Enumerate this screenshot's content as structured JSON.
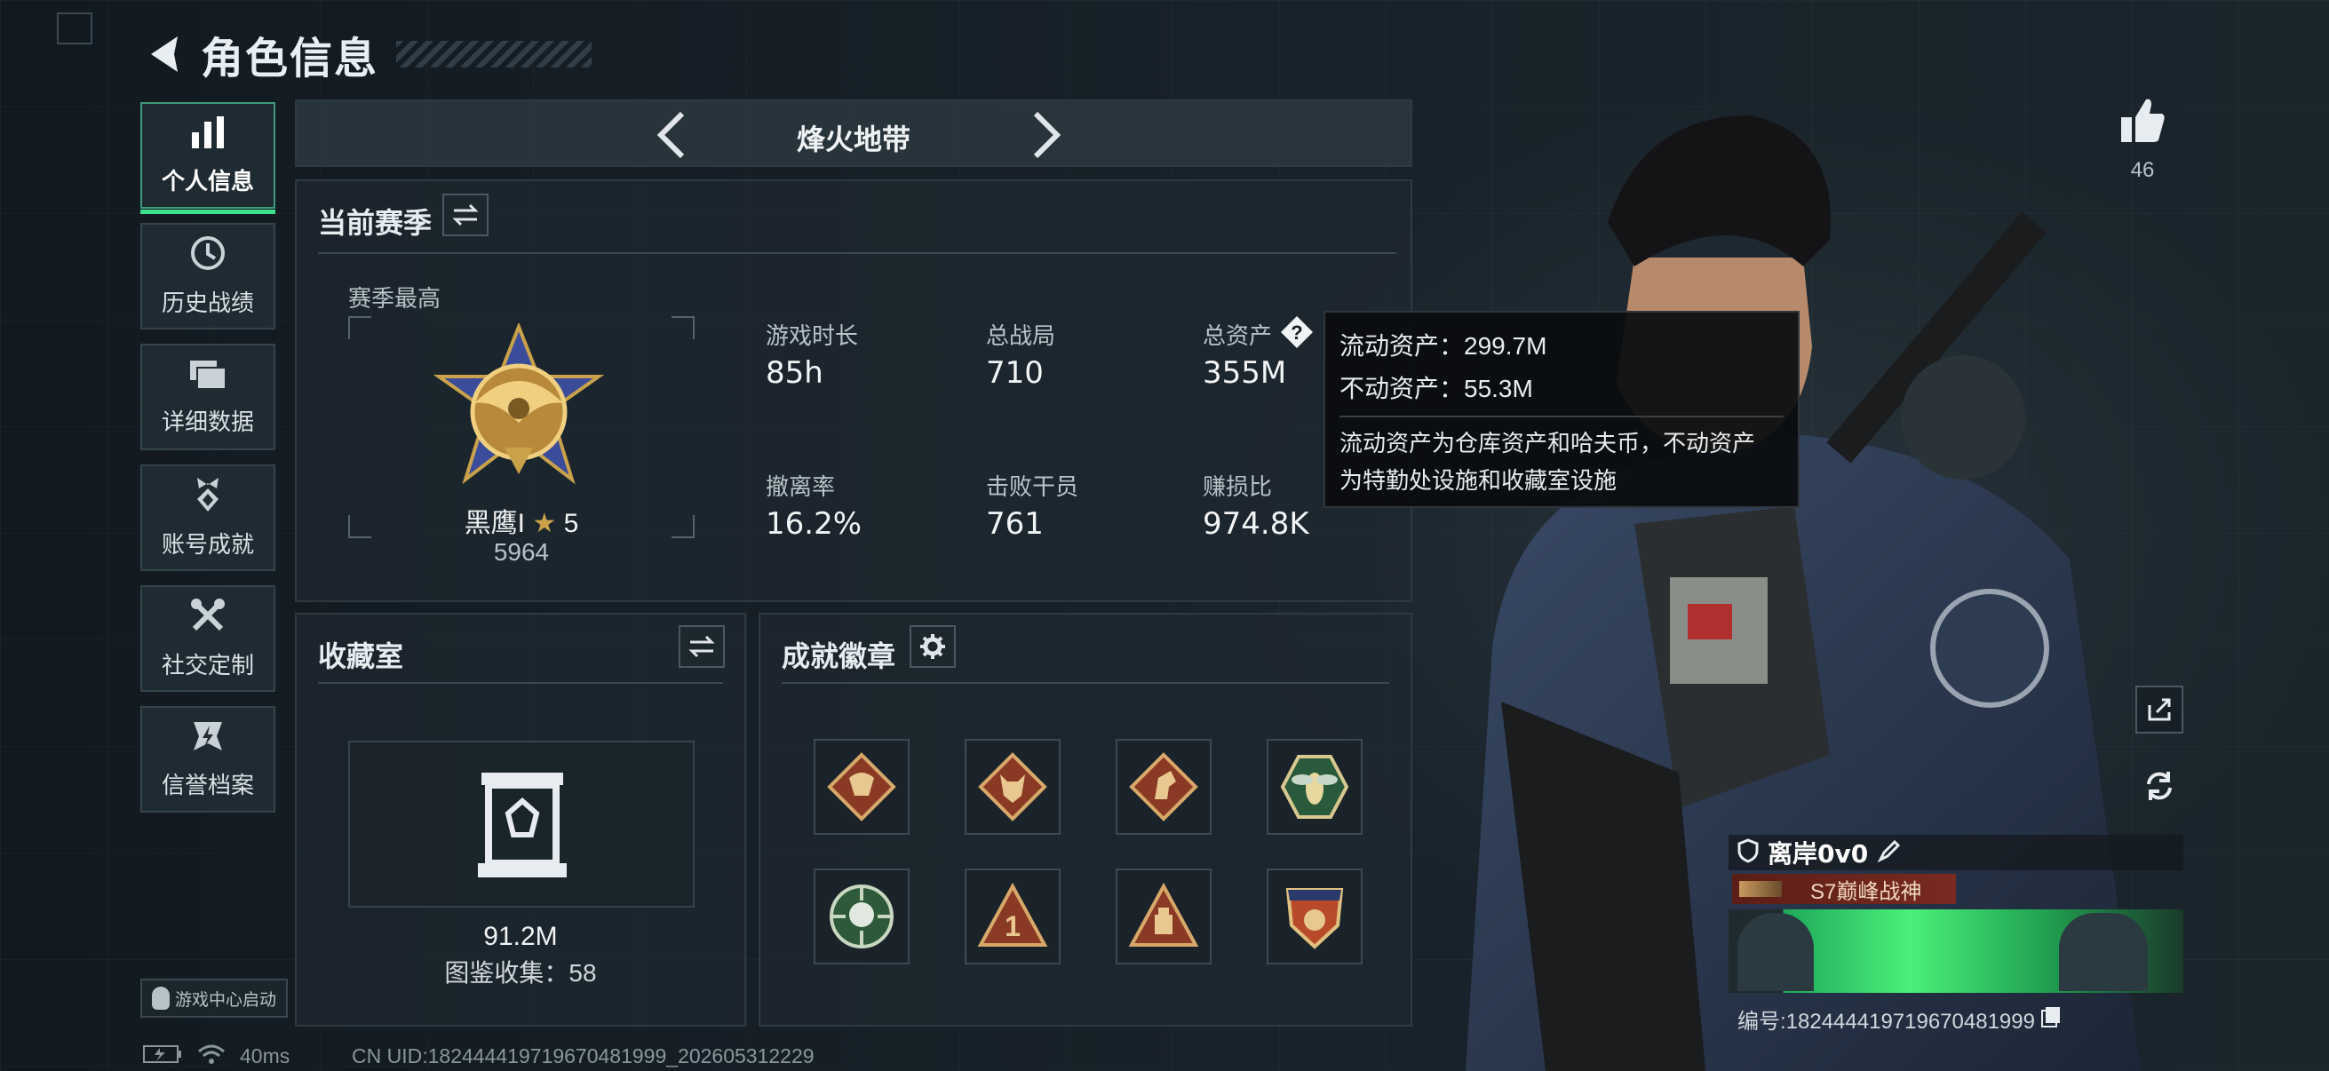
{
  "page": {
    "title": "角色信息"
  },
  "likes": {
    "count": "46"
  },
  "sidebar": {
    "items": [
      {
        "label": "个人信息",
        "icon": "bar-chart-icon",
        "active": true
      },
      {
        "label": "历史战绩",
        "icon": "history-icon"
      },
      {
        "label": "详细数据",
        "icon": "folder-icon"
      },
      {
        "label": "账号成就",
        "icon": "achievement-icon"
      },
      {
        "label": "社交定制",
        "icon": "tools-icon"
      },
      {
        "label": "信誉档案",
        "icon": "reputation-icon"
      }
    ],
    "game_center_label": "游戏中心启动"
  },
  "mode_switcher": {
    "label": "烽火地带"
  },
  "season": {
    "title": "当前赛季",
    "best_label": "赛季最高",
    "rank_name": "黑鹰I",
    "rank_stars": "5",
    "rank_score": "5964",
    "stats": [
      {
        "label": "游戏时长",
        "value": "85h"
      },
      {
        "label": "总战局",
        "value": "710"
      },
      {
        "label": "总资产",
        "value": "355M",
        "has_help": true
      },
      {
        "label": "撤离率",
        "value": "16.2%"
      },
      {
        "label": "击败干员",
        "value": "761"
      },
      {
        "label": "赚损比",
        "value": "974.8K"
      }
    ]
  },
  "tooltip": {
    "liquid": "流动资产：299.7M",
    "fixed": "不动资产：55.3M",
    "desc_line1": "流动资产为仓库资产和哈夫币，不动资产",
    "desc_line2": "为特勤处设施和收藏室设施"
  },
  "collection": {
    "title": "收藏室",
    "value": "91.2M",
    "catalog": "图鉴收集：58"
  },
  "badges": {
    "title": "成就徽章",
    "items": [
      "dragon-badge-icon",
      "wolf-badge-icon",
      "horse-badge-icon",
      "hornet-badge-icon",
      "skull-scope-badge-icon",
      "number-one-badge-icon",
      "supply-badge-icon",
      "eagle-shield-badge-icon"
    ]
  },
  "player_card": {
    "name": "离岸0v0",
    "title": "S7巅峰战神",
    "uid_label": "编号:18244441971967048199​9"
  },
  "status_bar": {
    "ping": "40ms",
    "uid": "CN UID:18244441971967048199​9_202605312229"
  },
  "colors": {
    "accent_green": "#3fe08a",
    "rank_gold": "#c9a24a",
    "title_red": "#7a2a20"
  }
}
